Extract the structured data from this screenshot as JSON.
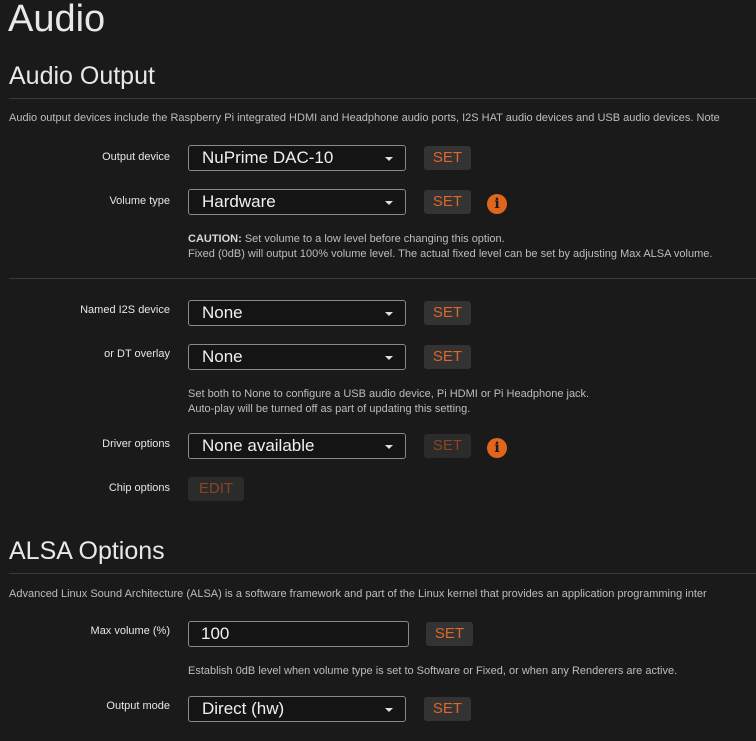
{
  "page": {
    "title": "Audio"
  },
  "audio_output": {
    "heading": "Audio Output",
    "description": "Audio output devices include the Raspberry Pi integrated HDMI and Headphone audio ports, I2S HAT audio devices and USB audio devices. Note",
    "output_device": {
      "label": "Output device",
      "value": "NuPrime DAC-10",
      "button": "SET"
    },
    "volume_type": {
      "label": "Volume type",
      "value": "Hardware",
      "button": "SET",
      "info_icon": "i",
      "caution_prefix": "CAUTION:",
      "caution_text": " Set volume to a low level before changing this option.",
      "caution_line2": "Fixed (0dB) will output 100% volume level. The actual fixed level can be set by adjusting Max ALSA volume."
    },
    "named_i2s": {
      "label": "Named I2S device",
      "value": "None",
      "button": "SET"
    },
    "dt_overlay": {
      "label": "or DT overlay",
      "value": "None",
      "button": "SET",
      "help_line1": "Set both to None to configure a USB audio device, Pi HDMI or Pi Headphone jack.",
      "help_line2": "Auto-play will be turned off as part of updating this setting."
    },
    "driver_options": {
      "label": "Driver options",
      "value": "None available",
      "button": "SET",
      "info_icon": "i"
    },
    "chip_options": {
      "label": "Chip options",
      "button": "EDIT"
    }
  },
  "alsa_options": {
    "heading": "ALSA Options",
    "description": "Advanced Linux Sound Architecture (ALSA) is a software framework and part of the Linux kernel that provides an application programming inter",
    "max_volume": {
      "label": "Max volume (%)",
      "value": "100",
      "button": "SET",
      "help": "Establish 0dB level when volume type is set to Software or Fixed, or when any Renderers are active."
    },
    "output_mode": {
      "label": "Output mode",
      "value": "Direct (hw)",
      "button": "SET"
    }
  },
  "colors": {
    "background": "#1a1a1a",
    "accent": "#e0652a",
    "button_bg": "#333333"
  }
}
